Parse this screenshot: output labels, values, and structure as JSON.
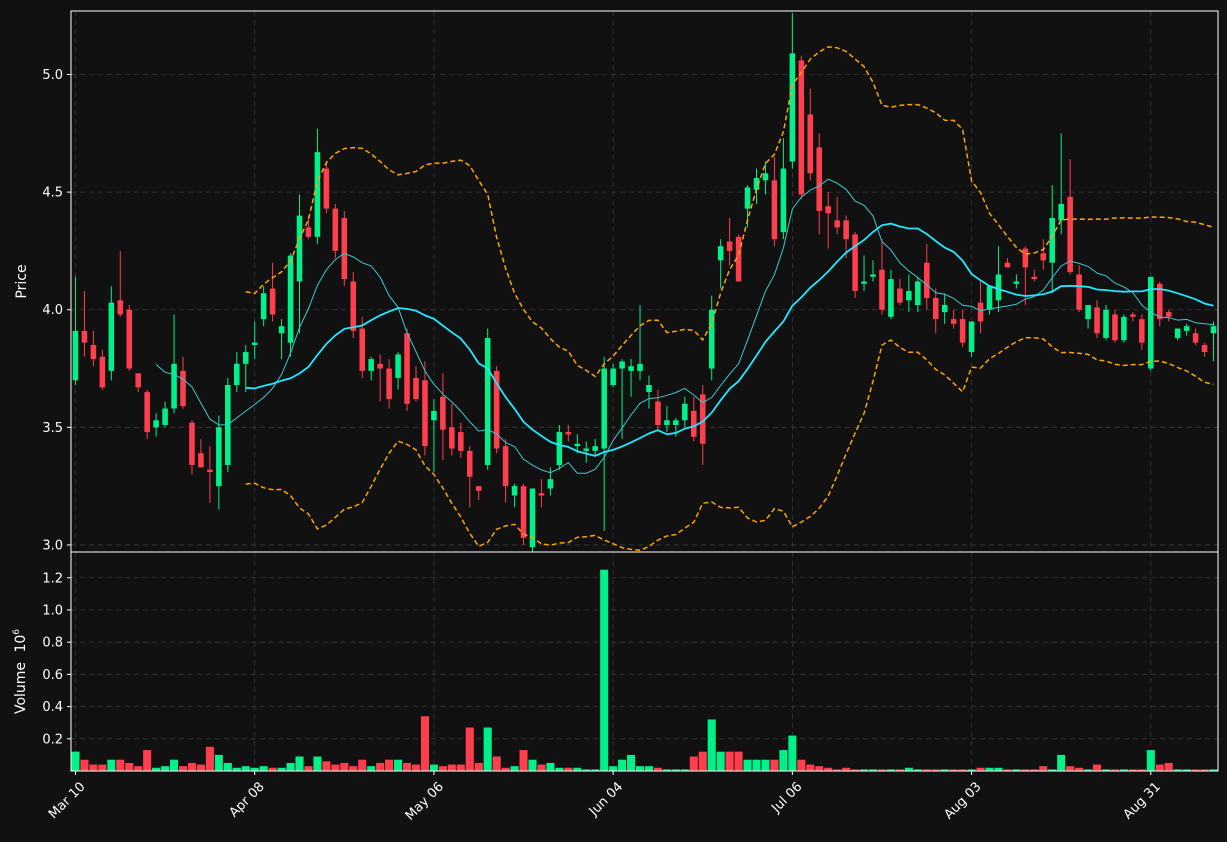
{
  "chart_data": {
    "type": "candlestick",
    "price_axis": {
      "label": "Price",
      "range": [
        2.97,
        5.27
      ],
      "ticks": [
        3.0,
        3.5,
        4.0,
        4.5,
        5.0
      ],
      "tick_labels": [
        "3.0",
        "3.5",
        "4.0",
        "4.5",
        "5.0"
      ]
    },
    "volume_axis": {
      "label": "Volume",
      "exponent": "6",
      "range": [
        0,
        1.36
      ],
      "ticks": [
        0.2,
        0.4,
        0.6,
        0.8,
        1.0,
        1.2
      ],
      "tick_labels": [
        "0.2",
        "0.4",
        "0.6",
        "0.8",
        "1.0",
        "1.2"
      ]
    },
    "x_axis": {
      "date_range": [
        "Mar 10",
        "Sep 04"
      ],
      "tick_labels": [
        "Mar 10",
        "Apr 08",
        "May 06",
        "Jun 04",
        "Jul 06",
        "Aug 03",
        "Aug 31"
      ],
      "tick_index": [
        0,
        20,
        40,
        60,
        80,
        100,
        120
      ]
    },
    "grid": true,
    "colors": {
      "background": "#111111",
      "up": "#00f08a",
      "down": "#ff3e4e",
      "ma_short": "#3cc8d0",
      "ma_long": "#20e8ff",
      "bollinger": "#ffa500",
      "grid": "#3a3a3a",
      "frame": "#ffffff"
    },
    "candles": [
      [
        "Mar 10",
        3.7,
        4.14,
        3.68,
        3.91,
        0.12
      ],
      [
        "Mar 11",
        3.91,
        4.08,
        3.8,
        3.86,
        0.07
      ],
      [
        "Mar 12",
        3.85,
        3.91,
        3.76,
        3.79,
        0.04
      ],
      [
        "Mar 13",
        3.8,
        3.83,
        3.66,
        3.67,
        0.04
      ],
      [
        "Mar 14",
        3.74,
        4.1,
        3.7,
        4.03,
        0.07
      ],
      [
        "Mar 17",
        4.04,
        4.25,
        3.97,
        3.98,
        0.07
      ],
      [
        "Mar 18",
        4.0,
        4.02,
        3.74,
        3.75,
        0.05
      ],
      [
        "Mar 19",
        3.73,
        3.72,
        3.65,
        3.67,
        0.03
      ],
      [
        "Mar 20",
        3.65,
        3.66,
        3.45,
        3.48,
        0.13
      ],
      [
        "Mar 21",
        3.5,
        3.56,
        3.46,
        3.53,
        0.02
      ],
      [
        "Mar 24",
        3.51,
        3.61,
        3.5,
        3.58,
        0.03
      ],
      [
        "Mar 25",
        3.58,
        3.98,
        3.56,
        3.77,
        0.07
      ],
      [
        "Mar 26",
        3.74,
        3.8,
        3.58,
        3.59,
        0.03
      ],
      [
        "Mar 27",
        3.52,
        3.53,
        3.3,
        3.34,
        0.05
      ],
      [
        "Mar 28",
        3.39,
        3.45,
        3.33,
        3.33,
        0.04
      ],
      [
        "Mar 31",
        3.32,
        3.42,
        3.18,
        3.31,
        0.15
      ],
      [
        "Apr 01",
        3.25,
        3.55,
        3.15,
        3.5,
        0.1
      ],
      [
        "Apr 02",
        3.34,
        3.71,
        3.31,
        3.68,
        0.05
      ],
      [
        "Apr 03",
        3.68,
        3.82,
        3.65,
        3.77,
        0.02
      ],
      [
        "Apr 04",
        3.77,
        3.85,
        3.65,
        3.82,
        0.03
      ],
      [
        "Apr 08",
        3.85,
        3.95,
        3.79,
        3.86,
        0.02
      ],
      [
        "Apr 09",
        3.96,
        4.1,
        3.93,
        4.07,
        0.03
      ],
      [
        "Apr 10",
        4.09,
        4.2,
        3.95,
        3.98,
        0.02
      ],
      [
        "Apr 11",
        3.9,
        3.96,
        3.79,
        3.93,
        0.02
      ],
      [
        "Apr 14",
        3.86,
        4.24,
        3.8,
        4.23,
        0.05
      ],
      [
        "Apr 15",
        4.12,
        4.49,
        3.9,
        4.4,
        0.09
      ],
      [
        "Apr 16",
        4.35,
        4.4,
        4.3,
        4.31,
        0.03
      ],
      [
        "Apr 17",
        4.31,
        4.77,
        4.28,
        4.67,
        0.09
      ],
      [
        "Apr 18",
        4.6,
        4.63,
        4.41,
        4.43,
        0.06
      ],
      [
        "Apr 21",
        4.43,
        4.45,
        4.22,
        4.25,
        0.04
      ],
      [
        "Apr 22",
        4.39,
        4.42,
        4.1,
        4.13,
        0.05
      ],
      [
        "Apr 23",
        4.12,
        4.16,
        3.88,
        3.91,
        0.03
      ],
      [
        "Apr 24",
        3.92,
        3.97,
        3.71,
        3.74,
        0.07
      ],
      [
        "Apr 25",
        3.74,
        3.8,
        3.7,
        3.79,
        0.03
      ],
      [
        "Apr 28",
        3.77,
        3.81,
        3.61,
        3.75,
        0.05
      ],
      [
        "Apr 29",
        3.75,
        3.79,
        3.58,
        3.62,
        0.07
      ],
      [
        "Apr 30",
        3.71,
        3.82,
        3.66,
        3.81,
        0.07
      ],
      [
        "May 01",
        3.9,
        3.92,
        3.57,
        3.6,
        0.05
      ],
      [
        "May 02",
        3.71,
        3.76,
        3.61,
        3.62,
        0.04
      ],
      [
        "May 05",
        3.7,
        3.78,
        3.38,
        3.42,
        0.34
      ],
      [
        "May 06",
        3.53,
        3.62,
        3.31,
        3.57,
        0.04
      ],
      [
        "May 07",
        3.63,
        3.73,
        3.36,
        3.49,
        0.03
      ],
      [
        "May 08",
        3.5,
        3.6,
        3.38,
        3.41,
        0.04
      ],
      [
        "May 09",
        3.48,
        3.52,
        3.37,
        3.4,
        0.04
      ],
      [
        "May 12",
        3.4,
        3.42,
        3.16,
        3.29,
        0.27
      ],
      [
        "May 13",
        3.25,
        3.25,
        3.19,
        3.23,
        0.05
      ],
      [
        "May 14",
        3.34,
        3.92,
        3.32,
        3.88,
        0.27
      ],
      [
        "May 15",
        3.74,
        3.76,
        3.39,
        3.41,
        0.09
      ],
      [
        "May 16",
        3.42,
        3.45,
        3.18,
        3.25,
        0.02
      ],
      [
        "May 19",
        3.21,
        3.26,
        3.16,
        3.25,
        0.03
      ],
      [
        "May 20",
        3.25,
        3.26,
        3.0,
        3.03,
        0.13
      ],
      [
        "May 21",
        2.99,
        3.24,
        2.97,
        3.24,
        0.07
      ],
      [
        "May 22",
        3.22,
        3.28,
        3.16,
        3.21,
        0.04
      ],
      [
        "May 23",
        3.24,
        3.33,
        3.21,
        3.28,
        0.05
      ],
      [
        "May 26",
        3.34,
        3.51,
        3.32,
        3.48,
        0.02
      ],
      [
        "May 27",
        3.48,
        3.51,
        3.44,
        3.47,
        0.02
      ],
      [
        "May 28",
        3.42,
        3.47,
        3.39,
        3.43,
        0.02
      ],
      [
        "May 29",
        3.4,
        3.44,
        3.35,
        3.41,
        0.01
      ],
      [
        "May 30",
        3.4,
        3.45,
        3.38,
        3.42,
        0.01
      ],
      [
        "Jun 02",
        3.41,
        3.8,
        3.06,
        3.75,
        1.25
      ],
      [
        "Jun 03",
        3.68,
        3.77,
        3.67,
        3.75,
        0.03
      ],
      [
        "Jun 04",
        3.75,
        3.79,
        3.45,
        3.78,
        0.07
      ],
      [
        "Jun 05",
        3.74,
        3.79,
        3.63,
        3.76,
        0.1
      ],
      [
        "Jun 06",
        3.74,
        4.02,
        3.7,
        3.77,
        0.03
      ],
      [
        "Jun 09",
        3.65,
        3.72,
        3.58,
        3.68,
        0.03
      ],
      [
        "Jun 10",
        3.61,
        3.66,
        3.49,
        3.51,
        0.02
      ],
      [
        "Jun 11",
        3.51,
        3.59,
        3.48,
        3.53,
        0.01
      ],
      [
        "Jun 12",
        3.51,
        3.54,
        3.46,
        3.53,
        0.01
      ],
      [
        "Jun 13",
        3.53,
        3.63,
        3.5,
        3.6,
        0.01
      ],
      [
        "Jun 16",
        3.57,
        3.63,
        3.44,
        3.46,
        0.09
      ],
      [
        "Jun 17",
        3.64,
        3.68,
        3.34,
        3.43,
        0.12
      ],
      [
        "Jun 18",
        3.75,
        4.06,
        3.7,
        4.0,
        0.32
      ],
      [
        "Jun 19",
        4.21,
        4.3,
        4.09,
        4.27,
        0.12
      ],
      [
        "Jun 20",
        4.29,
        4.39,
        4.19,
        4.25,
        0.12
      ],
      [
        "Jun 23",
        4.31,
        4.32,
        4.18,
        4.12,
        0.12
      ],
      [
        "Jun 24",
        4.43,
        4.53,
        4.35,
        4.52,
        0.07
      ],
      [
        "Jun 25",
        4.51,
        4.6,
        4.45,
        4.56,
        0.07
      ],
      [
        "Jun 26",
        4.55,
        4.63,
        4.49,
        4.58,
        0.07
      ],
      [
        "Jun 27",
        4.55,
        4.65,
        4.27,
        4.3,
        0.07
      ],
      [
        "Jun 30",
        4.33,
        4.73,
        4.3,
        4.6,
        0.13
      ],
      [
        "Jul 01",
        4.63,
        5.26,
        4.6,
        5.09,
        0.22
      ],
      [
        "Jul 02",
        5.06,
        5.08,
        4.47,
        4.49,
        0.07
      ],
      [
        "Jul 03",
        4.83,
        4.94,
        4.55,
        4.58,
        0.04
      ],
      [
        "Jul 04",
        4.69,
        4.75,
        4.32,
        4.42,
        0.03
      ],
      [
        "Jul 07",
        4.44,
        4.5,
        4.26,
        4.41,
        0.02
      ],
      [
        "Jul 08",
        4.38,
        4.48,
        4.32,
        4.35,
        0.01
      ],
      [
        "Jul 09",
        4.38,
        4.4,
        4.22,
        4.3,
        0.02
      ],
      [
        "Jul 10",
        4.32,
        4.33,
        4.05,
        4.08,
        0.01
      ],
      [
        "Jul 11",
        4.11,
        4.23,
        4.08,
        4.12,
        0.01
      ],
      [
        "Jul 14",
        4.14,
        4.21,
        4.12,
        4.15,
        0.01
      ],
      [
        "Jul 15",
        4.17,
        4.3,
        3.98,
        4.0,
        0.01
      ],
      [
        "Jul 16",
        3.97,
        4.17,
        3.96,
        4.13,
        0.01
      ],
      [
        "Jul 17",
        4.09,
        4.13,
        4.02,
        4.03,
        0.01
      ],
      [
        "Jul 18",
        4.04,
        4.15,
        3.99,
        4.08,
        0.02
      ],
      [
        "Jul 21",
        4.02,
        4.14,
        3.99,
        4.12,
        0.01
      ],
      [
        "Jul 22",
        4.2,
        4.28,
        4.0,
        4.05,
        0.01
      ],
      [
        "Jul 23",
        4.05,
        4.09,
        3.9,
        3.96,
        0.01
      ],
      [
        "Jul 24",
        3.99,
        4.07,
        3.94,
        4.02,
        0.01
      ],
      [
        "Jul 25",
        3.96,
        4.0,
        3.92,
        3.94,
        0.01
      ],
      [
        "Jul 28",
        3.96,
        4.0,
        3.84,
        3.86,
        0.01
      ],
      [
        "Jul 29",
        3.82,
        3.93,
        3.8,
        3.95,
        0.01
      ],
      [
        "Jul 30",
        4.03,
        4.12,
        3.9,
        3.95,
        0.02
      ],
      [
        "Jul 31",
        4.0,
        4.1,
        3.98,
        4.1,
        0.02
      ],
      [
        "Aug 01",
        4.04,
        4.27,
        3.99,
        4.15,
        0.02
      ],
      [
        "Aug 04",
        4.2,
        4.22,
        4.18,
        4.18,
        0.01
      ],
      [
        "Aug 05",
        4.11,
        4.15,
        4.09,
        4.12,
        0.01
      ],
      [
        "Aug 06",
        4.26,
        4.27,
        4.02,
        4.18,
        0.01
      ],
      [
        "Aug 07",
        4.14,
        4.17,
        4.12,
        4.13,
        0.01
      ],
      [
        "Aug 08",
        4.24,
        4.3,
        4.17,
        4.21,
        0.03
      ],
      [
        "Aug 11",
        4.2,
        4.53,
        4.07,
        4.39,
        0.01
      ],
      [
        "Aug 12",
        4.38,
        4.75,
        4.32,
        4.45,
        0.1
      ],
      [
        "Aug 13",
        4.48,
        4.64,
        4.15,
        4.16,
        0.03
      ],
      [
        "Aug 14",
        4.15,
        4.19,
        3.99,
        4.0,
        0.02
      ],
      [
        "Aug 15",
        3.96,
        4.02,
        3.92,
        4.02,
        0.01
      ],
      [
        "Aug 18",
        4.01,
        4.04,
        3.88,
        3.9,
        0.04
      ],
      [
        "Aug 19",
        3.88,
        4.02,
        3.87,
        4.0,
        0.01
      ],
      [
        "Aug 20",
        3.98,
        4.0,
        3.86,
        3.87,
        0.01
      ],
      [
        "Aug 21",
        3.87,
        3.98,
        3.86,
        3.97,
        0.01
      ],
      [
        "Aug 22",
        3.98,
        3.99,
        3.95,
        3.97,
        0.01
      ],
      [
        "Aug 25",
        3.96,
        3.98,
        3.83,
        3.86,
        0.01
      ],
      [
        "Aug 26",
        3.75,
        4.14,
        3.74,
        4.14,
        0.13
      ],
      [
        "Aug 27",
        4.11,
        4.12,
        3.93,
        3.96,
        0.04
      ],
      [
        "Aug 28",
        3.99,
        4.0,
        3.95,
        3.97,
        0.05
      ],
      [
        "Aug 29",
        3.88,
        3.92,
        3.87,
        3.92,
        0.01
      ],
      [
        "Sep 01",
        3.91,
        3.94,
        3.89,
        3.93,
        0.01
      ],
      [
        "Sep 02",
        3.9,
        3.92,
        3.85,
        3.86,
        0.01
      ],
      [
        "Sep 03",
        3.85,
        3.86,
        3.8,
        3.82,
        0.01
      ],
      [
        "Sep 04",
        3.9,
        3.95,
        3.78,
        3.93,
        0.01
      ]
    ]
  }
}
